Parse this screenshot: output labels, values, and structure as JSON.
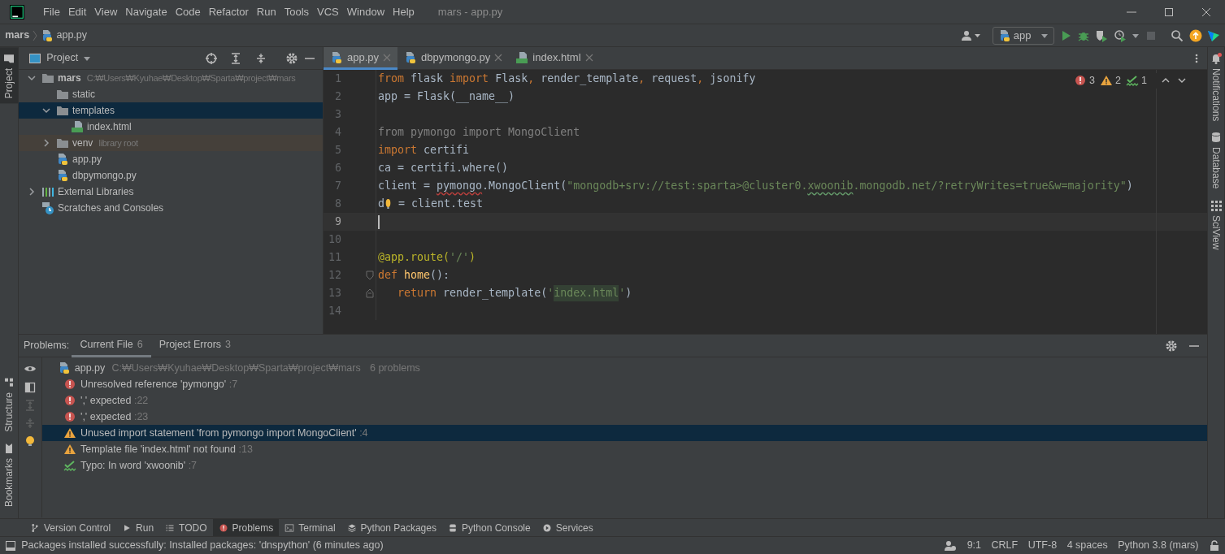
{
  "title_bar": {
    "menu": [
      "File",
      "Edit",
      "View",
      "Navigate",
      "Code",
      "Refactor",
      "Run",
      "Tools",
      "VCS",
      "Window",
      "Help"
    ],
    "title": "mars - app.py"
  },
  "nav_bar": {
    "breadcrumb": [
      "mars",
      "app.py"
    ],
    "run_config": "app"
  },
  "left_strip": {
    "top": [
      {
        "label": "Project",
        "kind": "project",
        "selected": true
      }
    ],
    "bottom": [
      {
        "label": "Structure",
        "kind": "structure",
        "selected": false
      },
      {
        "label": "Bookmarks",
        "kind": "bookmarks",
        "selected": false
      }
    ]
  },
  "right_strip": [
    {
      "label": "Notifications",
      "kind": "notifications"
    },
    {
      "label": "Database",
      "kind": "database"
    },
    {
      "label": "SciView",
      "kind": "sciview"
    }
  ],
  "project": {
    "title": "Project",
    "tree": [
      {
        "label": "mars",
        "kind": "module",
        "hint": "C:₩Users₩Kyuhae₩Desktop₩Sparta₩project₩mars",
        "expanded": true,
        "selected": false,
        "children": [
          {
            "label": "static",
            "kind": "folder",
            "selected": false
          },
          {
            "label": "templates",
            "kind": "folder",
            "expanded": true,
            "selected": true,
            "children": [
              {
                "label": "index.html",
                "kind": "html",
                "selected": false
              }
            ]
          },
          {
            "label": "venv",
            "kind": "library",
            "hint": "library root",
            "expanded": false,
            "selected": false
          },
          {
            "label": "app.py",
            "kind": "python",
            "selected": false
          },
          {
            "label": "dbpymongo.py",
            "kind": "python",
            "selected": false
          }
        ]
      },
      {
        "label": "External Libraries",
        "kind": "libraries",
        "expanded": false,
        "selected": false
      },
      {
        "label": "Scratches and Consoles",
        "kind": "scratches",
        "selected": false
      }
    ]
  },
  "editor": {
    "tabs": [
      {
        "label": "app.py",
        "kind": "python",
        "selected": true
      },
      {
        "label": "dbpymongo.py",
        "kind": "python",
        "selected": false
      },
      {
        "label": "index.html",
        "kind": "html",
        "selected": false
      }
    ],
    "inspections": {
      "errors": "3",
      "warnings": "2",
      "typos": "1"
    },
    "lines": [
      {
        "number": "1",
        "current": false,
        "kind": "plain",
        "tokens": [
          {
            "text": "from",
            "kind": "kw"
          },
          {
            "text": " flask ",
            "kind": "plain"
          },
          {
            "text": "import",
            "kind": "kw"
          },
          {
            "text": " Flask",
            "kind": "plain"
          },
          {
            "text": ",",
            "kind": "kw"
          },
          {
            "text": " render_template",
            "kind": "plain"
          },
          {
            "text": ",",
            "kind": "kw"
          },
          {
            "text": " request",
            "kind": "plain"
          },
          {
            "text": ",",
            "kind": "kw"
          },
          {
            "text": " jsonify",
            "kind": "plain"
          }
        ]
      },
      {
        "number": "2",
        "current": false,
        "kind": "plain",
        "tokens": [
          {
            "text": "app = Flask(__name__)",
            "kind": "plain"
          }
        ]
      },
      {
        "number": "3",
        "current": false,
        "kind": "plain"
      },
      {
        "number": "4",
        "current": false,
        "kind": "plain",
        "tokens": [
          {
            "text": "from pymongo import MongoClient",
            "kind": "unused"
          }
        ]
      },
      {
        "number": "5",
        "current": false,
        "kind": "plain",
        "tokens": [
          {
            "text": "import",
            "kind": "kw"
          },
          {
            "text": " certifi",
            "kind": "plain"
          }
        ]
      },
      {
        "number": "6",
        "current": false,
        "kind": "plain",
        "tokens": [
          {
            "text": "ca = certifi.where()",
            "kind": "plain"
          }
        ]
      },
      {
        "number": "7",
        "current": false,
        "kind": "plain",
        "tokens": [
          {
            "text": "client = ",
            "kind": "plain"
          },
          {
            "text": "pymongo",
            "kind": "plain_error"
          },
          {
            "text": ".MongoClient(",
            "kind": "plain"
          },
          {
            "text": "\"mongodb+srv://test:sparta>@cluster0.",
            "kind": "str"
          },
          {
            "text": "xwoonib",
            "kind": "str_typo"
          },
          {
            "text": ".mongodb.net/?retryWrites=true&w=majority\"",
            "kind": "str"
          },
          {
            "text": ")",
            "kind": "plain"
          }
        ]
      },
      {
        "number": "8",
        "current": false,
        "kind": "plain",
        "tokens": [
          {
            "text": "d",
            "kind": "plain"
          },
          {
            "kind": "bulb"
          },
          {
            "text": " = client.test",
            "kind": "plain"
          }
        ]
      },
      {
        "number": "9",
        "current": true,
        "kind": "plain",
        "tokens": [
          {
            "kind": "caret"
          }
        ]
      },
      {
        "number": "10",
        "current": false,
        "kind": "plain"
      },
      {
        "number": "11",
        "current": false,
        "kind": "plain",
        "tokens": [
          {
            "text": "@app.route(",
            "kind": "deco"
          },
          {
            "text": "'/'",
            "kind": "str"
          },
          {
            "text": ")",
            "kind": "deco"
          }
        ]
      },
      {
        "number": "12",
        "current": false,
        "kind": "fold_start",
        "tokens": [
          {
            "text": "def ",
            "kind": "kw"
          },
          {
            "text": "home",
            "kind": "fn"
          },
          {
            "text": "():",
            "kind": "plain"
          }
        ]
      },
      {
        "number": "13",
        "current": false,
        "kind": "fold_end",
        "tokens": [
          {
            "kind": "indent"
          },
          {
            "text": "return",
            "kind": "kw"
          },
          {
            "text": " render_template(",
            "kind": "plain"
          },
          {
            "text": "'",
            "kind": "str"
          },
          {
            "text": "index.html",
            "kind": "str_match"
          },
          {
            "text": "'",
            "kind": "str"
          },
          {
            "text": ")",
            "kind": "plain"
          }
        ]
      },
      {
        "number": "14",
        "current": false,
        "kind": "plain"
      }
    ]
  },
  "problems": {
    "label": "Problems:",
    "tabs": [
      {
        "label": "Current File",
        "count": "6",
        "selected": true
      },
      {
        "label": "Project Errors",
        "count": "3",
        "selected": false
      }
    ],
    "file": {
      "name": "app.py",
      "path": "C:₩Users₩Kyuhae₩Desktop₩Sparta₩project₩mars",
      "summary": "6 problems"
    },
    "items": [
      {
        "kind": "error",
        "text": "Unresolved reference 'pymongo'",
        "location": ":7",
        "selected": false
      },
      {
        "kind": "error",
        "text": "',' expected",
        "location": ":22",
        "selected": false
      },
      {
        "kind": "error",
        "text": "',' expected",
        "location": ":23",
        "selected": false
      },
      {
        "kind": "warning",
        "text": "Unused import statement 'from pymongo import MongoClient'",
        "location": ":4",
        "selected": true
      },
      {
        "kind": "warning",
        "text": "Template file 'index.html' not found",
        "location": ":13",
        "selected": false
      },
      {
        "kind": "typo",
        "text": "Typo: In word 'xwoonib'",
        "location": ":7",
        "selected": false
      }
    ]
  },
  "tool_windows": [
    {
      "label": "Version Control",
      "kind": "vcs",
      "selected": false
    },
    {
      "label": "Run",
      "kind": "run",
      "selected": false
    },
    {
      "label": "TODO",
      "kind": "todo",
      "selected": false
    },
    {
      "label": "Problems",
      "kind": "problems",
      "selected": true
    },
    {
      "label": "Terminal",
      "kind": "terminal",
      "selected": false
    },
    {
      "label": "Python Packages",
      "kind": "packages",
      "selected": false
    },
    {
      "label": "Python Console",
      "kind": "console",
      "selected": false
    },
    {
      "label": "Services",
      "kind": "services",
      "selected": false
    }
  ],
  "status_bar": {
    "message": "Packages installed successfully: Installed packages: 'dnspython' (6 minutes ago)",
    "items": [
      "9:1",
      "CRLF",
      "UTF-8",
      "4 spaces",
      "Python 3.8 (mars)"
    ]
  }
}
